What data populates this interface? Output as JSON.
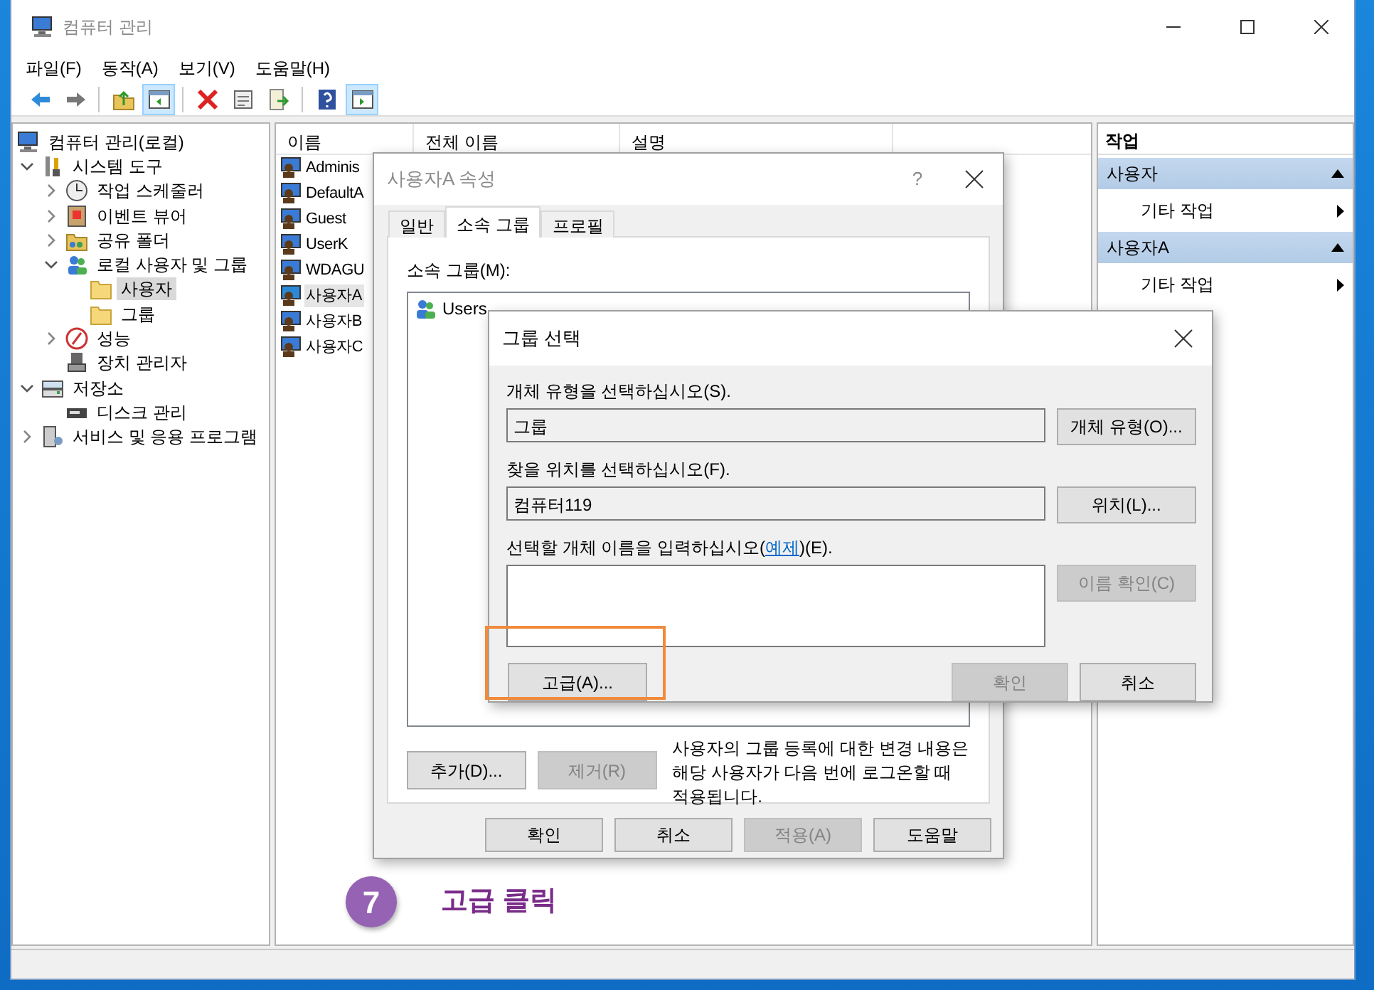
{
  "window": {
    "title": "컴퓨터 관리"
  },
  "menu": [
    "파일(F)",
    "동작(A)",
    "보기(V)",
    "도움말(H)"
  ],
  "toolbar": [
    {
      "kind": "back",
      "pressed": false
    },
    {
      "kind": "forward",
      "pressed": false
    },
    {
      "kind": "up",
      "pressed": false
    },
    {
      "kind": "tree",
      "pressed": true
    },
    {
      "kind": "delete",
      "pressed": false
    },
    {
      "kind": "properties",
      "pressed": false
    },
    {
      "kind": "export",
      "pressed": false
    },
    {
      "kind": "help",
      "pressed": false
    },
    {
      "kind": "actions",
      "pressed": true
    }
  ],
  "tree": {
    "label": "컴퓨터 관리(로컬)",
    "kind": "computer",
    "selected": false,
    "children": [
      {
        "label": "시스템 도구",
        "kind": "tools",
        "selected": false,
        "expanded": true,
        "children": [
          {
            "label": "작업 스케줄러",
            "kind": "clock",
            "selected": false,
            "expanded": false
          },
          {
            "label": "이벤트 뷰어",
            "kind": "log",
            "selected": false,
            "expanded": false
          },
          {
            "label": "공유 폴더",
            "kind": "share",
            "selected": false,
            "expanded": false
          },
          {
            "label": "로컬 사용자 및 그룹",
            "kind": "users",
            "selected": false,
            "expanded": true,
            "children": [
              {
                "label": "사용자",
                "kind": "folder",
                "selected": true
              },
              {
                "label": "그룹",
                "kind": "folder",
                "selected": false
              }
            ]
          },
          {
            "label": "성능",
            "kind": "gauge",
            "selected": false,
            "expanded": false
          },
          {
            "label": "장치 관리자",
            "kind": "device",
            "selected": false
          }
        ]
      },
      {
        "label": "저장소",
        "kind": "storage",
        "selected": false,
        "expanded": true,
        "children": [
          {
            "label": "디스크 관리",
            "kind": "disk",
            "selected": false
          }
        ]
      },
      {
        "label": "서비스 및 응용 프로그램",
        "kind": "services",
        "selected": false,
        "expanded": false
      }
    ]
  },
  "list": {
    "columns": [
      "이름",
      "전체 이름",
      "설명"
    ],
    "rows": [
      {
        "name": "Adminis",
        "selected": false
      },
      {
        "name": "DefaultA",
        "selected": false
      },
      {
        "name": "Guest",
        "selected": false
      },
      {
        "name": "UserK",
        "selected": false
      },
      {
        "name": "WDAGU",
        "selected": false
      },
      {
        "name": "사용자A",
        "selected": true
      },
      {
        "name": "사용자B",
        "selected": false
      },
      {
        "name": "사용자C",
        "selected": false
      }
    ]
  },
  "actions": {
    "title": "작업",
    "sections": [
      {
        "title": "사용자",
        "expanded": true,
        "items": [
          "기타 작업"
        ]
      },
      {
        "title": "사용자A",
        "expanded": true,
        "items": [
          "기타 작업"
        ]
      }
    ]
  },
  "properties_dialog": {
    "title": "사용자A 속성",
    "help": "?",
    "tabs": [
      {
        "label": "일반",
        "selected": false
      },
      {
        "label": "소속 그룹",
        "selected": true
      },
      {
        "label": "프로필",
        "selected": false
      }
    ],
    "members_label": "소속 그룹(M):",
    "members": [
      "Users"
    ],
    "buttons": [
      {
        "label": "추가(D)...",
        "disabled": false
      },
      {
        "label": "제거(R)",
        "disabled": true
      }
    ],
    "note": "사용자의 그룹 등록에 대한 변경 내용은 해당 사용자가 다음 번에 로그온할 때 적용됩니다.",
    "footer_buttons": [
      {
        "label": "확인",
        "disabled": false
      },
      {
        "label": "취소",
        "disabled": false
      },
      {
        "label": "적용(A)",
        "disabled": true
      },
      {
        "label": "도움말",
        "disabled": false
      }
    ]
  },
  "group_dialog": {
    "title": "그룹 선택",
    "fields": [
      {
        "label": "개체 유형을 선택하십시오(S).",
        "value": "그룹",
        "button": {
          "label": "개체 유형(O)...",
          "disabled": false
        }
      },
      {
        "label": "찾을 위치를 선택하십시오(F).",
        "value": "컴퓨터119",
        "button": {
          "label": "위치(L)...",
          "disabled": false
        }
      }
    ],
    "names": {
      "label_before": "선택할 개체 이름을 입력하십시오(",
      "link": "예제",
      "label_after": ")(E).",
      "button": {
        "label": "이름 확인(C)",
        "disabled": true
      }
    },
    "footer_buttons": [
      {
        "label": "고급(A)...",
        "disabled": false
      },
      {
        "label": "확인",
        "disabled": true
      },
      {
        "label": "취소",
        "disabled": false
      }
    ]
  },
  "annotation": {
    "step": "7",
    "text": "고급 클릭"
  }
}
